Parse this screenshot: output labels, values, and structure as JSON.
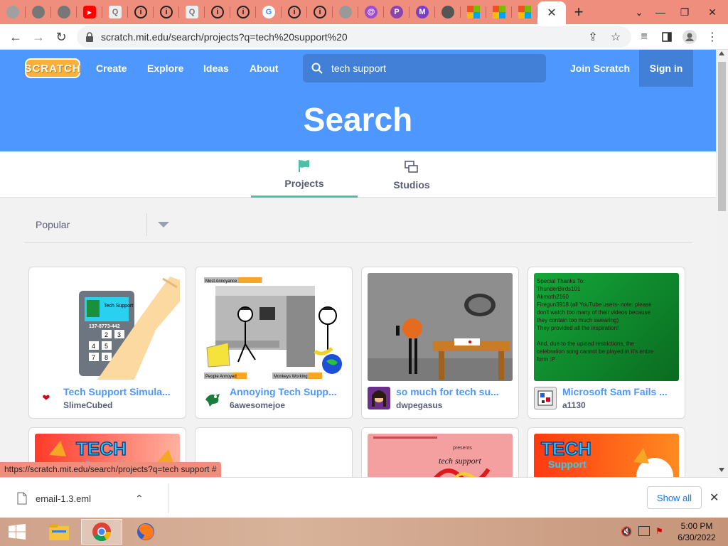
{
  "browser": {
    "tabs": [
      {
        "icon": "scratch-tab-icon",
        "color": "#a0a0a0",
        "glyph": ""
      },
      {
        "icon": "globe-tab-icon",
        "color": "#777777",
        "glyph": ""
      },
      {
        "icon": "globe-tab-icon",
        "color": "#777777",
        "glyph": ""
      },
      {
        "icon": "youtube-tab-icon",
        "color": "#ff0000",
        "glyph": "▶"
      },
      {
        "icon": "search-tab-icon",
        "color": "#bbbbbb",
        "glyph": "Q"
      },
      {
        "icon": "info-tab-icon",
        "color": "#222222",
        "glyph": "i"
      },
      {
        "icon": "info-tab-icon",
        "color": "#222222",
        "glyph": "i"
      },
      {
        "icon": "search-tab-icon",
        "color": "#bbbbbb",
        "glyph": "Q"
      },
      {
        "icon": "info-tab-icon",
        "color": "#222222",
        "glyph": "i"
      },
      {
        "icon": "info-tab-icon",
        "color": "#222222",
        "glyph": "i"
      },
      {
        "icon": "google-tab-icon",
        "color": "#4285f4",
        "glyph": "G"
      },
      {
        "icon": "info-tab-icon",
        "color": "#222222",
        "glyph": "i"
      },
      {
        "icon": "info-tab-icon",
        "color": "#222222",
        "glyph": "i"
      },
      {
        "icon": "globe-tab-icon",
        "color": "#999999",
        "glyph": ""
      },
      {
        "icon": "at-tab-icon",
        "color": "#9c4dcc",
        "glyph": "@"
      },
      {
        "icon": "p-tab-icon",
        "color": "#8e44ad",
        "glyph": "P"
      },
      {
        "icon": "mail-tab-icon",
        "color": "#7b3fc4",
        "glyph": "M"
      },
      {
        "icon": "chrome-tab-icon",
        "color": "#555555",
        "glyph": ""
      },
      {
        "icon": "microsoft-tab-icon",
        "color": "#f25022",
        "glyph": ""
      },
      {
        "icon": "microsoft-tab-icon",
        "color": "#f25022",
        "glyph": ""
      },
      {
        "icon": "microsoft-tab-icon",
        "color": "#f25022",
        "glyph": ""
      }
    ],
    "url": "scratch.mit.edu/search/projects?q=tech%20support%20",
    "status_url": "https://scratch.mit.edu/search/projects?q=tech support #"
  },
  "scratch": {
    "logo_text": "SCRATCH",
    "nav": {
      "create": "Create",
      "explore": "Explore",
      "ideas": "Ideas",
      "about": "About",
      "join": "Join Scratch",
      "signin": "Sign in"
    },
    "search_query": "tech support",
    "banner_title": "Search",
    "tabs": {
      "projects": "Projects",
      "studios": "Studios"
    },
    "sort_label": "Popular",
    "projects": [
      {
        "title": "Tech Support Simula...",
        "author": "SlimeCubed"
      },
      {
        "title": "Annoying Tech Supp...",
        "author": "6awesomejoe"
      },
      {
        "title": "so much for tech su...",
        "author": "dwpegasus"
      },
      {
        "title": "Microsoft Sam Fails ...",
        "author": "a1130"
      }
    ],
    "thumb_text": {
      "tech_support": "Tech Support",
      "phone_number": "137-8773-442",
      "keys": [
        "2",
        "3",
        "4",
        "5",
        "7",
        "8"
      ],
      "most_annoyance": "Most Annoyance",
      "people_annoyed": "People Annoyed",
      "monkeys_working": "Monkeys Working",
      "credits": [
        "Special Thanks To:",
        "ThunderBirds101",
        "Akmoth2160",
        "Firegun3918 (all YouTube users- note: please",
        "don't watch too many of their videos because",
        "they contain too much swearing)",
        "They provided all the inspiration!",
        "",
        "And, due to the upload restrictions, the",
        "celebration song cannot be played in it's entire",
        "form :P"
      ],
      "tech": "TECH",
      "support": "Support",
      "tech_support_lower": "tech support",
      "presents": "presents"
    }
  },
  "downloads": {
    "filename": "email-1.3.eml",
    "show_all": "Show all"
  },
  "taskbar": {
    "time": "5:00 PM",
    "date": "6/30/2022"
  }
}
